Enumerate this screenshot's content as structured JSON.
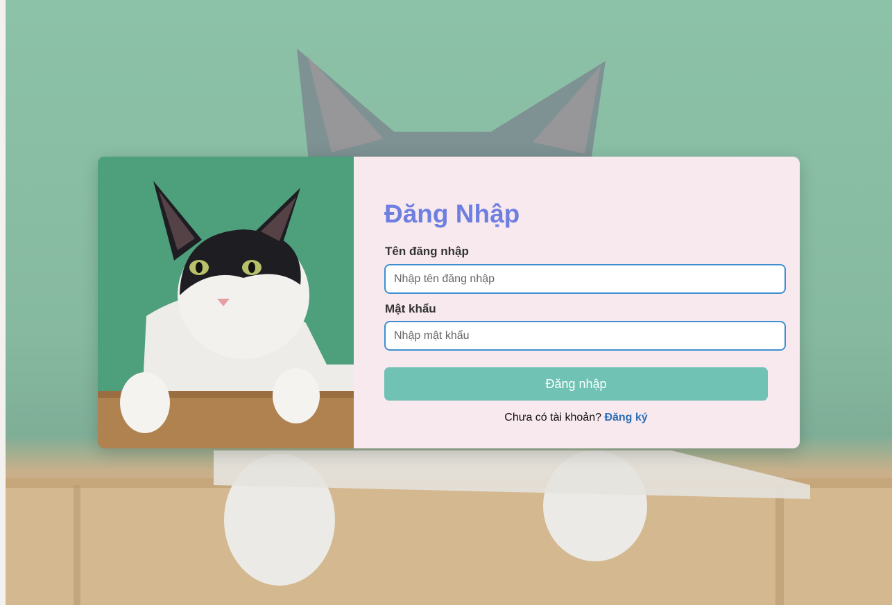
{
  "login": {
    "title": "Đăng Nhập",
    "username_label": "Tên đăng nhập",
    "username_placeholder": "Nhập tên đăng nhập",
    "password_label": "Mật khẩu",
    "password_placeholder": "Nhập mật khẩu",
    "submit_label": "Đăng nhập",
    "signup_prompt": "Chưa có tài khoản?",
    "signup_link": "Đăng ký"
  },
  "colors": {
    "title": "#6e7fe0",
    "button": "#6fc2b4",
    "input_border": "#3d8fd0",
    "link": "#2b6fb5",
    "panel_bg": "#f8e9ef",
    "background_wall": "#8cc2a8"
  },
  "icons": {
    "background": "cat-photo",
    "card_image": "cat-photo"
  }
}
